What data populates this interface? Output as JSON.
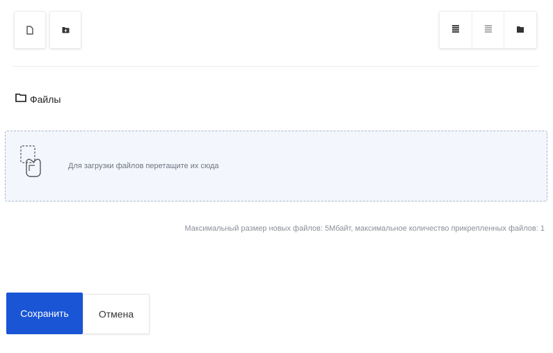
{
  "toolbar": {
    "left_buttons": [
      {
        "name": "new-file",
        "icon": "file-icon"
      },
      {
        "name": "new-folder",
        "icon": "folder-plus-icon"
      }
    ],
    "view_buttons": [
      {
        "name": "view-table",
        "icon": "table-view-icon"
      },
      {
        "name": "view-list",
        "icon": "list-view-icon"
      },
      {
        "name": "view-folder",
        "icon": "folder-view-icon"
      }
    ]
  },
  "folder": {
    "icon": "folder-icon",
    "label": "Файлы"
  },
  "dropzone": {
    "icon": "drag-files-icon",
    "text": "Для загрузки файлов перетащите их сюда"
  },
  "limits_note": "Максимальный размер новых файлов: 5Мбайт, максимальное количество прикрепленных файлов: 1",
  "actions": {
    "save_label": "Сохранить",
    "cancel_label": "Отмена"
  },
  "colors": {
    "primary": "#1a55d6",
    "dropzone_bg": "#f3f6fc",
    "dropzone_border": "#aab6c9"
  }
}
